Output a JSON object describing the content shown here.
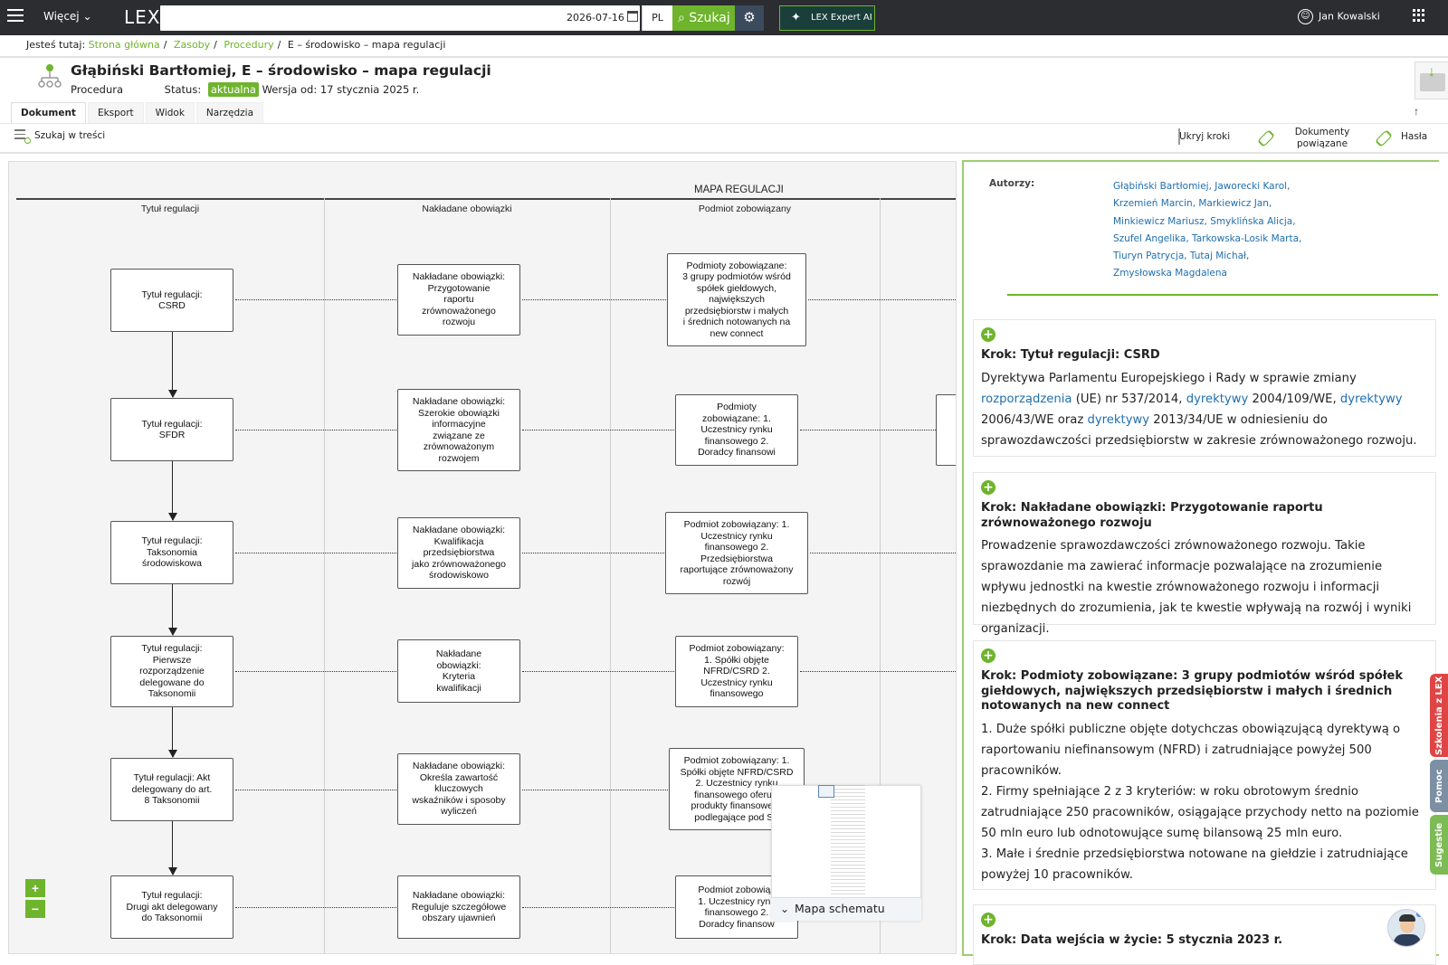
{
  "topbar": {
    "more_label": "Więcej",
    "logo": "LEX",
    "search_date": "2026-07-16",
    "lang": "PL",
    "search_label": "Szukaj",
    "expert_label": "LEX Expert AI",
    "user_name": "Jan Kowalski"
  },
  "breadcrumb": {
    "prefix": "Jesteś tutaj:",
    "items": [
      "Strona główna",
      "Zasoby",
      "Procedury"
    ],
    "current": "E – środowisko – mapa regulacji"
  },
  "document": {
    "title": "Głąbiński Bartłomiej, E – środowisko – mapa regulacji",
    "type": "Procedura",
    "status_label": "Status:",
    "status": "aktualna",
    "version": "Wersja od: 17 stycznia 2025 r."
  },
  "tabs": [
    "Dokument",
    "Eksport",
    "Widok",
    "Narzędzia"
  ],
  "toolbar": {
    "search_in_content": "Szukaj w treści",
    "hide_steps": "Ukryj kroki",
    "related_docs_line1": "Dokumenty",
    "related_docs_line2": "powiązane",
    "passwords": "Hasła"
  },
  "diagram": {
    "title": "MAPA REGULACJI",
    "columns": [
      "Tytuł regulacji",
      "Nakładane obowiązki",
      "Podmiot zobowiązany"
    ],
    "rows": [
      {
        "title_node": "Tytuł regulacji:\nCSRD",
        "duty_node": "Nakładane obowiązki:\nPrzygotowanie\nraportu\nzrównoważonego\nrozwoju",
        "subject_node": "Podmioty zobowiązane:\n3 grupy podmiotów wśród\nspółek giełdowych,\nnajwiększych\nprzedsiębiorstw i małych\ni średnich notowanych na\nnew connect"
      },
      {
        "title_node": "Tytuł regulacji:\nSFDR",
        "duty_node": "Nakładane obowiązki:\nSzerokie obowiązki\ninformacyjne\nzwiązane ze\nzrównoważonym\nrozwojem",
        "subject_node": "Podmioty\nzobowiązane: 1.\nUczestnicy rynku\nfinansowego 2.\nDoradcy finansowi"
      },
      {
        "title_node": "Tytuł regulacji:\nTaksonomia\nśrodowiskowa",
        "duty_node": "Nakładane obowiązki:\nKwalifikacja\nprzedsiębiorstwa\njako zrównoważonego\nśrodowiskowo",
        "subject_node": "Podmiot zobowiązany: 1.\nUczestnicy rynku\nfinansowego 2.\nPrzedsiębiorstwa\nraportujące zrównoważony\nrozwój"
      },
      {
        "title_node": "Tytuł regulacji:\nPierwsze\nrozporządzenie\ndelegowane do\nTaksonomii",
        "duty_node": "Nakładane\nobowiązki:\nKryteria\nkwalifikacji",
        "subject_node": "Podmiot zobowiązany:\n1. Spółki objęte\nNFRD/CSRD 2.\nUczestnicy rynku\nfinansowego"
      },
      {
        "title_node": "Tytuł regulacji: Akt\ndelegowany do art.\n8 Taksonomii",
        "duty_node": "Nakładane obowiązki:\nOkreśla zawartość\nkluczowych\nwskaźników i sposoby\nwyliczeń",
        "subject_node": "Podmiot zobowiązany: 1.\nSpółki objęte NFRD/CSRD\n2. Uczestnicy rynku\nfinansowego oferują\nprodukty finansowe w\npodlegające pod SF"
      },
      {
        "title_node": "Tytuł regulacji:\nDrugi akt delegowany\ndo Taksonomii",
        "duty_node": "Nakładane obowiązki:\nReguluje szczegółowe\nobszary ujawnień",
        "subject_node": "Podmiot zobowiąz\n1. Uczestnicy rynk\nfinansowego 2.\nDoradcy finansow"
      }
    ],
    "zoom_in": "+",
    "zoom_out": "−",
    "minimap_label": "Mapa schematu"
  },
  "right_panel": {
    "authors_label": "Autorzy:",
    "authors": [
      "Głąbiński Bartłomiej, Jaworecki Karol,",
      "Krzemień Marcin, Markiewicz Jan,",
      "Minkiewicz Mariusz, Smyklińska Alicja,",
      "Szufel Angelika, Tarkowska-Losik Marta,",
      "Tiuryn Patrycja, Tutaj Michał,",
      "Zmysłowska Magdalena"
    ],
    "step1": {
      "title": "Krok: Tytuł regulacji: CSRD",
      "t1": "Dyrektywa Parlamentu Europejskiego i Rady w sprawie zmiany ",
      "l1": "rozporządzenia",
      "t2": " (UE) nr 537/2014, ",
      "l2": "dyrektywy",
      "t3": " 2004/109/WE, ",
      "l3": "dyrektywy",
      "t4": " 2006/43/WE oraz ",
      "l4": "dyrektywy",
      "t5": " 2013/34/UE w odniesieniu do sprawozdawczości przedsiębiorstw w zakresie zrównoważonego rozwoju."
    },
    "step2": {
      "title": "Krok: Nakładane obowiązki: Przygotowanie raportu zrównoważonego rozwoju",
      "body": "Prowadzenie sprawozdawczości zrównoważonego rozwoju. Takie sprawozdanie ma zawierać informacje pozwalające na zrozumienie wpływu jednostki na kwestie zrównoważonego rozwoju i informacji niezbędnych do zrozumienia, jak te kwestie wpływają na rozwój i wyniki organizacji."
    },
    "step3": {
      "title": "Krok: Podmioty zobowiązane: 3 grupy podmiotów wśród spółek giełdowych, największych przedsiębiorstw i małych i średnich notowanych na new connect",
      "p1": "1. Duże spółki publiczne objęte dotychczas obowiązującą dyrektywą o raportowaniu niefinansowym (NFRD) i zatrudniające powyżej 500 pracowników.",
      "p2": "2. Firmy spełniające 2 z 3 kryteriów: w roku obrotowym średnio zatrudniające 250 pracowników, osiągające przychody netto na poziomie 50 mln euro lub odnotowujące sumę bilansową 25 mln euro.",
      "p3": "3. Małe i średnie przedsiębiorstwa notowane na giełdzie i zatrudniające powyżej 10 pracowników."
    },
    "step4": {
      "title": "Krok: Data wejścia w życie: 5 stycznia 2023 r."
    }
  },
  "side_tabs": [
    "Szkolenia z LEX",
    "Pomoc",
    "Sugestie"
  ],
  "colors": {
    "accent_green": "#6eb42c",
    "topbar": "#2b2d31",
    "link_blue": "#1f6fae",
    "side_red": "#e04545",
    "side_gray": "#7d8fa3",
    "side_green": "#7dbb55"
  }
}
